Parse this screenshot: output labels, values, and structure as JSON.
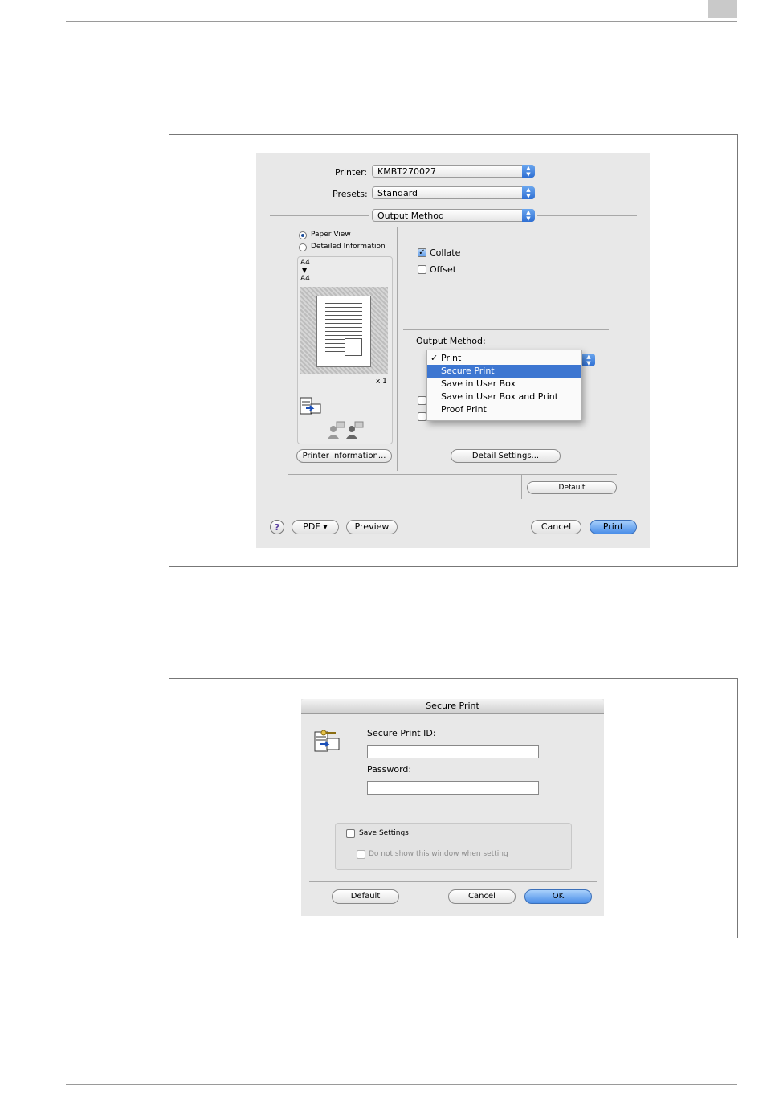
{
  "print_dialog": {
    "printer_label": "Printer:",
    "printer_value": "KMBT270027",
    "presets_label": "Presets:",
    "presets_value": "Standard",
    "panel_value": "Output Method",
    "view_options": [
      "Paper View",
      "Detailed Information"
    ],
    "paper_from": "A4",
    "paper_arrow": "▼",
    "paper_to": "A4",
    "copies": "x 1",
    "collate_label": "Collate",
    "offset_label": "Offset",
    "output_method_label": "Output Method:",
    "output_menu": {
      "items": [
        "Print",
        "Secure Print",
        "Save in User Box",
        "Save in User Box and Print",
        "Proof Print"
      ],
      "checked": "Print",
      "highlighted": "Secure Print"
    },
    "printer_information_button": "Printer Information...",
    "detail_settings_button": "Detail Settings...",
    "default_button": "Default",
    "help_label": "?",
    "pdf_button": "PDF ▾",
    "preview_button": "Preview",
    "cancel_button": "Cancel",
    "print_button": "Print"
  },
  "secure_dialog": {
    "title": "Secure Print",
    "id_label": "Secure Print ID:",
    "id_value": "",
    "password_label": "Password:",
    "password_value": "",
    "save_settings_label": "Save Settings",
    "do_not_show_label": "Do not show this window when setting",
    "default_button": "Default",
    "cancel_button": "Cancel",
    "ok_button": "OK"
  },
  "colors": {
    "accent_blue": "#3d76d1",
    "button_blue": "#4a8ee8",
    "dialog_bg": "#e8e8e8"
  }
}
